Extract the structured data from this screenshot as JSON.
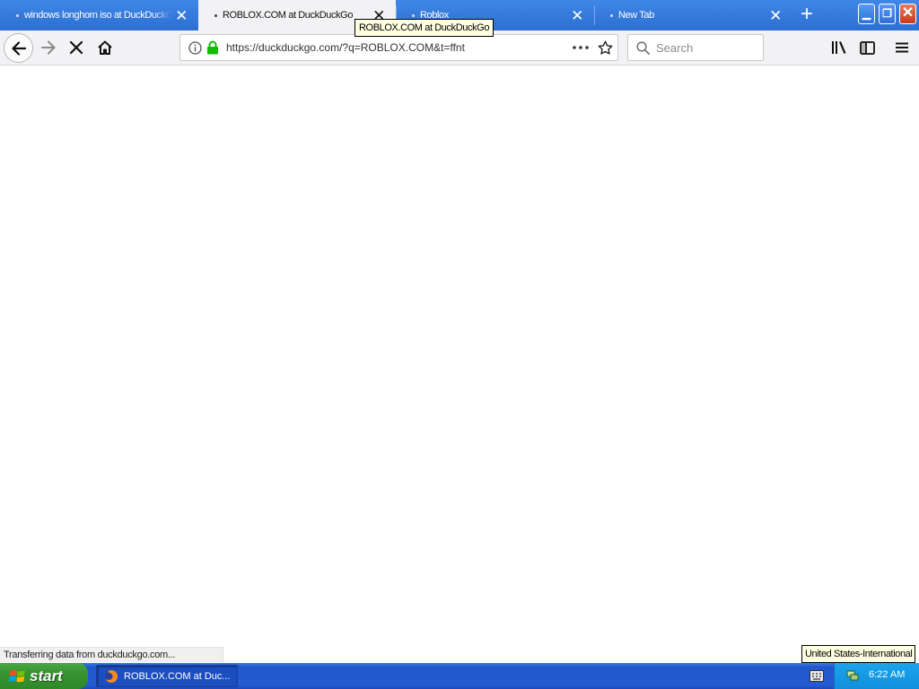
{
  "browser": {
    "tabs": [
      {
        "title": "windows longhorn iso at DuckDuckGo",
        "selected": false
      },
      {
        "title": "ROBLOX.COM at DuckDuckGo",
        "selected": true
      },
      {
        "title": "Roblox",
        "selected": false
      },
      {
        "title": "New Tab",
        "selected": false
      }
    ],
    "url": "https://duckduckgo.com/?q=ROBLOX.COM&t=ffnt",
    "search_placeholder": "Search",
    "tooltip": "ROBLOX.COM at DuckDuckGo",
    "status": "Transferring data from duckduckgo.com...",
    "accent_color": "#2d6fd2",
    "secure_lock_color": "#12bc00"
  },
  "taskbar": {
    "start_label": "start",
    "task_label": "ROBLOX.COM at Duc...",
    "clock": "6:22 AM",
    "language_tooltip": "United States-International"
  }
}
